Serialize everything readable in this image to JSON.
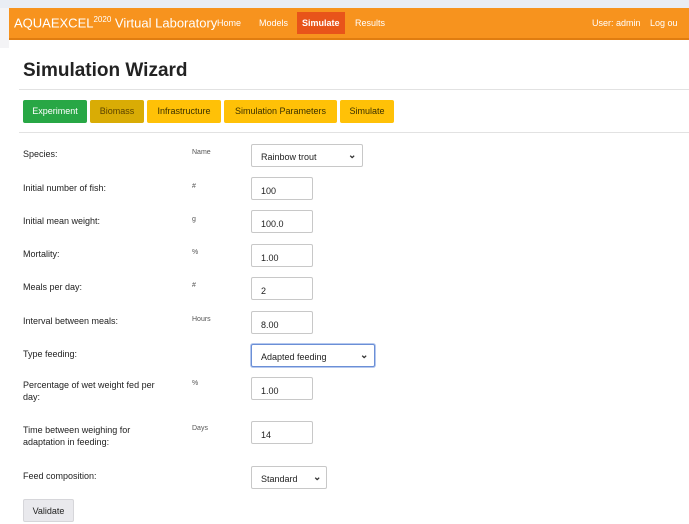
{
  "navbar": {
    "brand_name": "AQUAEXCEL",
    "brand_sup": "2020",
    "brand_suffix": "Virtual Laboratory",
    "links": [
      "Home",
      "Models",
      "Simulate",
      "Results"
    ],
    "active_link": "Simulate",
    "user": "User: admin",
    "logout": "Log ou"
  },
  "colors": {
    "navbar": "#f7931e",
    "active_link": "#e8541a",
    "step_done": "#28a745",
    "step_current": "#d9ac05",
    "step_todo": "#ffc107"
  },
  "page": {
    "title": "Simulation Wizard"
  },
  "steps": [
    "Experiment",
    "Biomass",
    "Infrastructure",
    "Simulation Parameters",
    "Simulate"
  ],
  "form": {
    "species": {
      "label": "Species:",
      "unit": "Name",
      "value": "Rainbow trout"
    },
    "initial_number": {
      "label": "Initial number of fish:",
      "unit": "#",
      "value": "100"
    },
    "initial_weight": {
      "label": "Initial mean weight:",
      "unit": "g",
      "value": "100.0"
    },
    "mortality": {
      "label": "Mortality:",
      "unit": "%",
      "value": "1.00"
    },
    "meals": {
      "label": "Meals per day:",
      "unit": "#",
      "value": "2"
    },
    "interval": {
      "label": "Interval between meals:",
      "unit": "Hours",
      "value": "8.00"
    },
    "type_feeding": {
      "label": "Type feeding:",
      "unit": "",
      "value": "Adapted feeding"
    },
    "percentage": {
      "label": "Percentage of wet weight fed per day:",
      "unit": "%",
      "value": "1.00"
    },
    "time_weighing": {
      "label": "Time between weighing for adaptation in feeding:",
      "unit": "Days",
      "value": "14"
    },
    "feed_composition": {
      "label": "Feed composition:",
      "unit": "",
      "value": "Standard"
    }
  },
  "validate_label": "Validate",
  "icons": {
    "dropdown": "chevron-down-icon"
  }
}
